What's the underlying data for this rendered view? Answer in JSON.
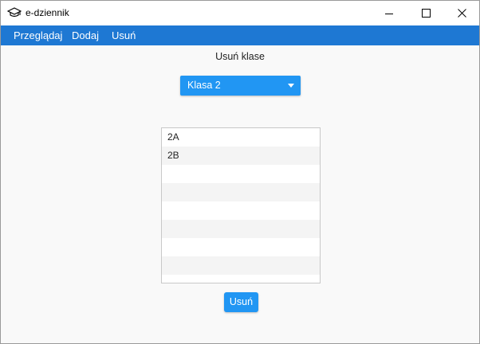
{
  "window": {
    "title": "e-dziennik",
    "app_icon": "graduation-cap-icon",
    "controls": [
      "minimize-icon",
      "maximize-icon",
      "close-icon"
    ]
  },
  "menu": {
    "items": [
      {
        "label": "Przeglądaj"
      },
      {
        "label": "Dodaj"
      },
      {
        "label": "Usuń"
      }
    ]
  },
  "main": {
    "title": "Usuń klase",
    "class_select": {
      "value": "Klasa 2"
    },
    "list": {
      "rows": [
        "2A",
        "2B",
        "",
        "",
        "",
        "",
        "",
        ""
      ]
    },
    "action_button": "Usuń"
  },
  "colors": {
    "menubar": "#1e78d3",
    "accent": "#2196f3",
    "background": "#f9f9f9"
  }
}
